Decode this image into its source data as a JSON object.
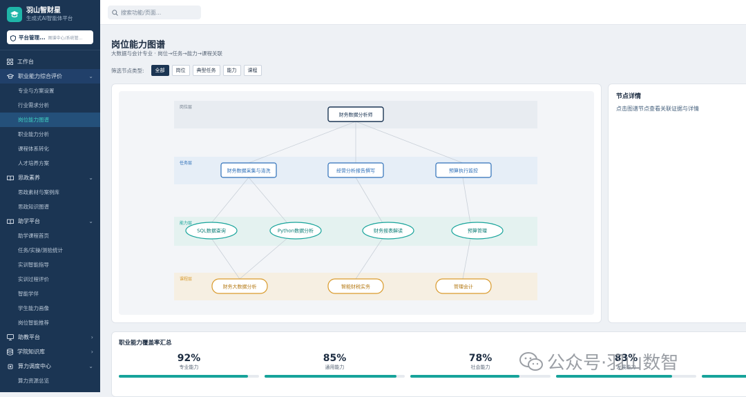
{
  "brand": {
    "title": "羽山智财星",
    "subtitle": "生成式AI智能体平台"
  },
  "org": {
    "name": "平台管理...",
    "sub": "图谱中心/系统管..."
  },
  "sidebar": {
    "items": [
      {
        "label": "工作台",
        "icon": "grid-icon",
        "chev": ""
      },
      {
        "label": "职业能力综合评价",
        "icon": "graduation-cap-icon",
        "chev": "⌄",
        "open": true,
        "children": [
          "专业与方案设置",
          "行业需求分析",
          "岗位能力图谱",
          "职业能力分析",
          "课程体系转化",
          "人才培养方案"
        ]
      },
      {
        "label": "思政素养",
        "icon": "book-icon",
        "chev": "⌄",
        "children": [
          "思政素材与案例库",
          "思政知识图谱"
        ]
      },
      {
        "label": "助学平台",
        "icon": "book-icon",
        "chev": "⌄",
        "children": [
          "助学课程首页",
          "任务/实操/测验统计",
          "实训智能指导",
          "实训过程评价",
          "智能学伴",
          "学生能力画像",
          "岗位智能推荐"
        ]
      },
      {
        "label": "助教平台",
        "icon": "monitor-icon",
        "chev": "›"
      },
      {
        "label": "学院知识库",
        "icon": "database-icon",
        "chev": "›"
      },
      {
        "label": "算力调度中心",
        "icon": "chip-icon",
        "chev": "⌄",
        "children": [
          "算力资源总览"
        ]
      }
    ],
    "active": "岗位能力图谱"
  },
  "search": {
    "placeholder": "搜索功能/页面..."
  },
  "page": {
    "title": "岗位能力图谱",
    "subtitle": "大数据与会计专业 · 岗位→任务→能力→课程关联"
  },
  "filters": {
    "label": "筛选节点类型:",
    "options": [
      "全部",
      "岗位",
      "典型任务",
      "能力",
      "课程"
    ],
    "selected": "全部"
  },
  "graph": {
    "layers": {
      "job": "岗位层",
      "task": "任务层",
      "ability": "能力层",
      "course": "课程层"
    },
    "nodes": {
      "job": "财务数据分析师",
      "task1": "财务数据采集与清洗",
      "task2": "经营分析报告撰写",
      "task3": "预算执行监控",
      "ab1": "SQL数据查询",
      "ab2": "Python数据分析",
      "ab3": "财务报表解读",
      "ab4": "预算管理",
      "c1": "财务大数据分析",
      "c2": "智能财税实务",
      "c3": "管理会计"
    },
    "colors": {
      "job": "#1b3553",
      "task": "#2d6fb8",
      "ability": "#16a39a",
      "course": "#d99a2b"
    }
  },
  "detail": {
    "title": "节点详情",
    "hint": "点击图谱节点查看关联证据与详情"
  },
  "coverage": {
    "title": "职业能力覆盖率汇总",
    "metrics": [
      {
        "value": "92%",
        "label": "专业能力",
        "fill": 0.92
      },
      {
        "value": "85%",
        "label": "通用能力",
        "fill": 0.94
      },
      {
        "value": "78%",
        "label": "社会能力",
        "fill": 0.78
      },
      {
        "value": "83%",
        "label": "发展能力",
        "fill": 0.83
      },
      {
        "value": "",
        "label": "",
        "fill": 1.0
      }
    ]
  },
  "watermark": {
    "text": "公众号·羽山数智"
  }
}
